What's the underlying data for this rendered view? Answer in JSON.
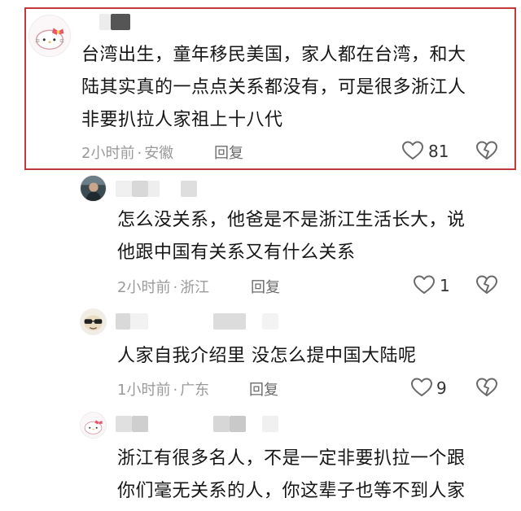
{
  "colors": {
    "highlight_border": "#c0393b",
    "meta_text": "#9a9a9a",
    "reply_text": "#6b6b6b",
    "icon": "#6a6a6a"
  },
  "comments": [
    {
      "avatar_icon": "hello-kitty-avatar-icon",
      "text_lines": [
        "台湾出生，童年移民美国，家人都在台湾，和大",
        "陆其实真的一点点关系都没有，可是很多浙江人",
        "非要扒拉人家祖上十八代"
      ],
      "time": "2小时前",
      "location": "安徽",
      "reply_label": "回复",
      "like_icon": "heart-outline-icon",
      "likes": "81",
      "dislike_icon": "broken-heart-icon"
    },
    {
      "avatar_icon": "photo-avatar-icon",
      "text_lines": [
        "怎么没关系，他爸是不是浙江生活长大，说",
        "他跟中国有关系又有什么关系"
      ],
      "time": "2小时前",
      "location": "浙江",
      "reply_label": "回复",
      "like_icon": "heart-outline-icon",
      "likes": "1",
      "dislike_icon": "broken-heart-icon"
    },
    {
      "avatar_icon": "cartoon-face-avatar-icon",
      "text_lines": [
        "人家自我介绍里 没怎么提中国大陆呢"
      ],
      "time": "1小时前",
      "location": "广东",
      "reply_label": "回复",
      "like_icon": "heart-outline-icon",
      "likes": "9",
      "dislike_icon": "broken-heart-icon"
    },
    {
      "avatar_icon": "hello-kitty-avatar-icon",
      "text_lines": [
        "浙江有很多名人，不是一定非要扒拉一个跟",
        "你们毫无关系的人，你这辈子也等不到人家"
      ]
    }
  ],
  "separator": "·"
}
